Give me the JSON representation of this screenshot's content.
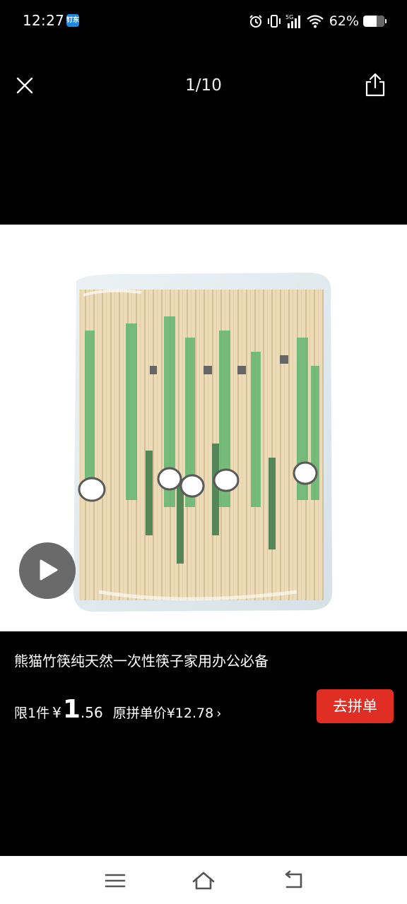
{
  "status_bar": {
    "time": "12:27",
    "app_icon_text": "钉东",
    "network": "5G",
    "battery": "62%",
    "battery_level": 0.62
  },
  "viewer": {
    "counter": "1/10",
    "close_icon": "close-icon",
    "share_icon": "share-icon",
    "play_icon": "play-icon"
  },
  "product": {
    "title": "熊猫竹筷纯天然一次性筷子家用办公必备",
    "limit_label": "限1件",
    "currency": "¥",
    "price_int": "1",
    "price_dec": ".56",
    "original_price": "原拼单价¥12.78",
    "chevron": "›",
    "group_buy_button": "去拼单",
    "button_color": "#e02e24"
  },
  "nav_bar": {
    "menu_icon": "menu-icon",
    "home_icon": "home-icon",
    "back_icon": "back-icon"
  }
}
